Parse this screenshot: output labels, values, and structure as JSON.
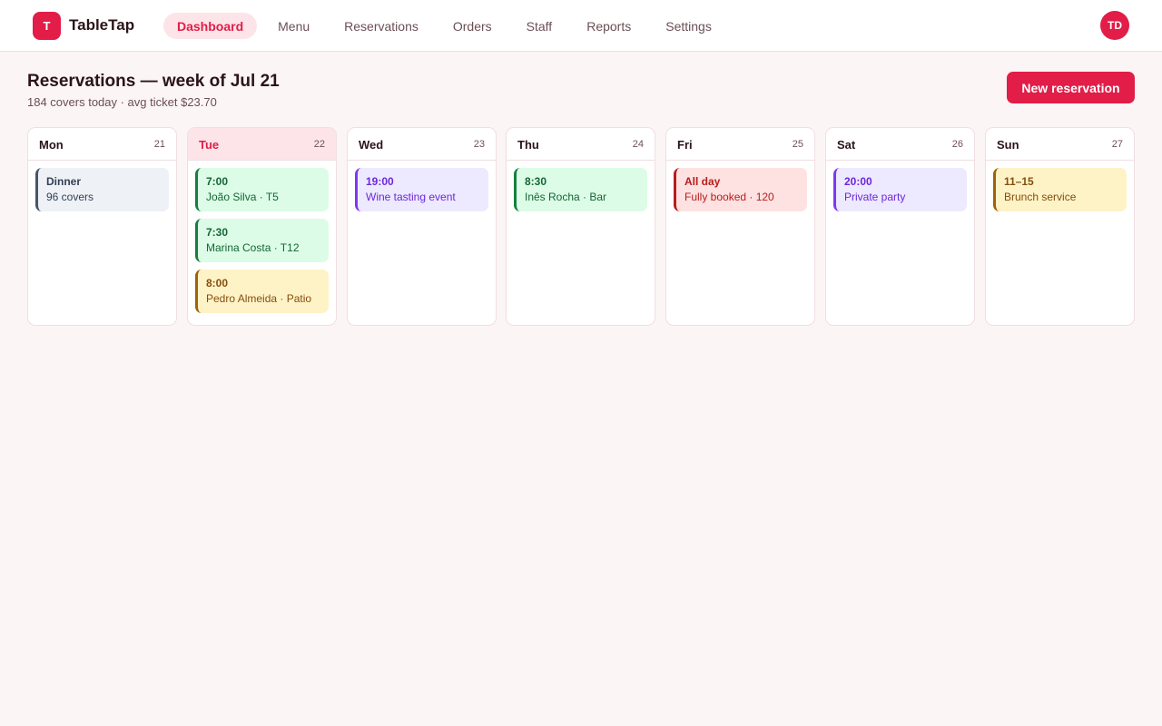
{
  "app": {
    "logo_letter": "T",
    "name": "TableTap"
  },
  "nav": [
    {
      "label": "Dashboard",
      "active": true
    },
    {
      "label": "Menu"
    },
    {
      "label": "Reservations"
    },
    {
      "label": "Orders"
    },
    {
      "label": "Staff"
    },
    {
      "label": "Reports"
    },
    {
      "label": "Settings"
    }
  ],
  "user": {
    "initials": "TD"
  },
  "header": {
    "title": "Reservations — week of Jul 21",
    "subtitle": "184 covers today · avg ticket $23.70",
    "new_button": "New reservation"
  },
  "days": [
    {
      "name": "Mon",
      "num": "21",
      "events": [
        {
          "title": "Dinner",
          "sub": "96 covers",
          "color": "slate"
        }
      ]
    },
    {
      "name": "Tue",
      "num": "22",
      "today": true,
      "events": [
        {
          "title": "7:00",
          "sub": "João Silva · T5",
          "color": "green"
        },
        {
          "title": "7:30",
          "sub": "Marina Costa · T12",
          "color": "green"
        },
        {
          "title": "8:00",
          "sub": "Pedro Almeida · Patio",
          "color": "amber"
        }
      ]
    },
    {
      "name": "Wed",
      "num": "23",
      "events": [
        {
          "title": "19:00",
          "sub": "Wine tasting event",
          "color": "purple"
        }
      ]
    },
    {
      "name": "Thu",
      "num": "24",
      "events": [
        {
          "title": "8:30",
          "sub": "Inês Rocha · Bar",
          "color": "green"
        }
      ]
    },
    {
      "name": "Fri",
      "num": "25",
      "events": [
        {
          "title": "All day",
          "sub": "Fully booked · 120",
          "color": "red"
        }
      ]
    },
    {
      "name": "Sat",
      "num": "26",
      "events": [
        {
          "title": "20:00",
          "sub": "Private party",
          "color": "purple"
        }
      ]
    },
    {
      "name": "Sun",
      "num": "27",
      "events": [
        {
          "title": "11–15",
          "sub": "Brunch service",
          "color": "amber"
        }
      ]
    }
  ],
  "colors": {
    "accent": "#e11d48",
    "background": "#fcf5f5"
  }
}
